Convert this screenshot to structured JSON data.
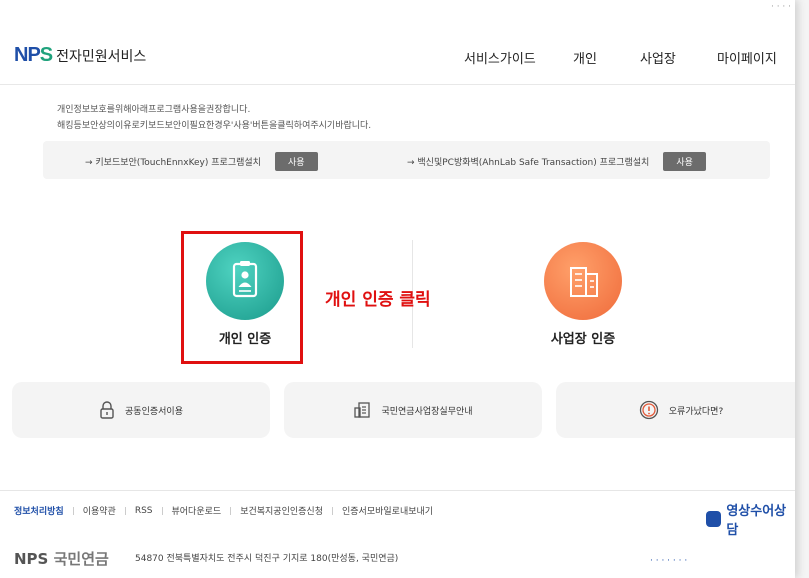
{
  "header": {
    "logo_mark_a": "NP",
    "logo_mark_b": "S",
    "service_name": "전자민원서비스",
    "nav": [
      "서비스가이드",
      "개인",
      "사업장",
      "마이페이지"
    ]
  },
  "notice": {
    "line1": "개인정보보호를위해아래프로그램사용을권장합니다.",
    "line2": "해킹등보안상의이유로키보드보안이필요한경우'사용'버튼을클릭하여주시기바랍니다."
  },
  "install": {
    "item1_label": "→ 키보드보안(TouchEnnxKey) 프로그램설치",
    "item1_button": "사용",
    "item2_label": "→ 백신및PC방화벽(AhnLab Safe Transaction) 프로그램설치",
    "item2_button": "사용"
  },
  "auth": {
    "personal_label": "개인 인증",
    "business_label": "사업장 인증",
    "annotation": "개인 인증 클릭"
  },
  "cards": {
    "card1": "공동인증서이용",
    "card2": "국민연금사업장실무안내",
    "card3": "오류가났다면?"
  },
  "footer": {
    "links": [
      "정보처리방침",
      "이용약관",
      "RSS",
      "뷰어다운로드",
      "보건복지공인인증신청",
      "인증서모바일로내보내기"
    ],
    "consult": "영상수어상담",
    "logo_a": "NPS",
    "logo_b": "국민연금",
    "address": "54870 전북특별자치도 전주시 덕진구 기지로 180(만성동, 국민연금)"
  },
  "colors": {
    "brand_blue": "#1f4fa8",
    "brand_green": "#1fa27c",
    "personal_teal": "#1a9a8b",
    "business_orange": "#ef6a3a",
    "annotation_red": "#e01010"
  }
}
